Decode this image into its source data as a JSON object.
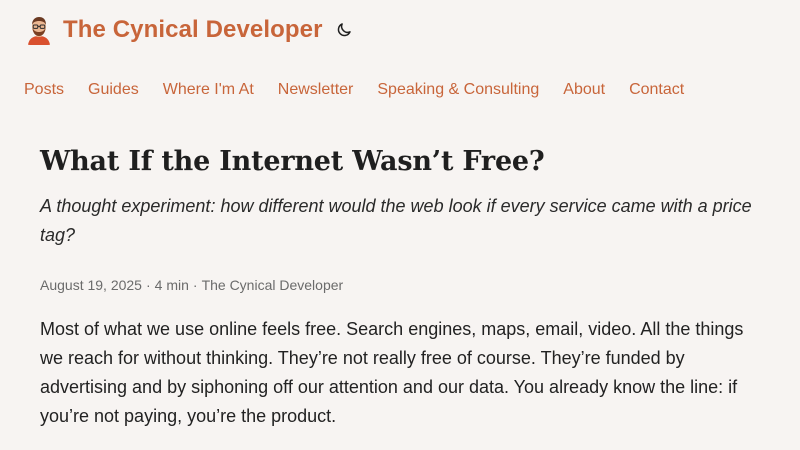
{
  "site": {
    "title": "The Cynical Developer",
    "avatar_icon": "developer-avatar-icon",
    "theme_toggle_icon": "moon-icon"
  },
  "nav": {
    "items": [
      {
        "label": "Posts"
      },
      {
        "label": "Guides"
      },
      {
        "label": "Where I'm At"
      },
      {
        "label": "Newsletter"
      },
      {
        "label": "Speaking & Consulting"
      },
      {
        "label": "About"
      },
      {
        "label": "Contact"
      }
    ]
  },
  "post": {
    "title": "What If the Internet Wasn’t Free?",
    "subtitle": "A thought experiment: how different would the web look if every service came with a price tag?",
    "meta": {
      "date": "August 19, 2025",
      "separator": "·",
      "read_time": "4 min",
      "author": "The Cynical Developer"
    },
    "body_paragraph": "Most of what we use online feels free. Search engines, maps, email, video. All the things we reach for without thinking. They’re not really free of course. They’re funded by advertising and by siphoning off our attention and our data. You already know the line: if you’re not paying, you’re the product."
  },
  "colors": {
    "accent": "#c8653a",
    "background": "#f7f4f2",
    "text": "#1f1f1f",
    "muted": "#6b6b6b"
  }
}
